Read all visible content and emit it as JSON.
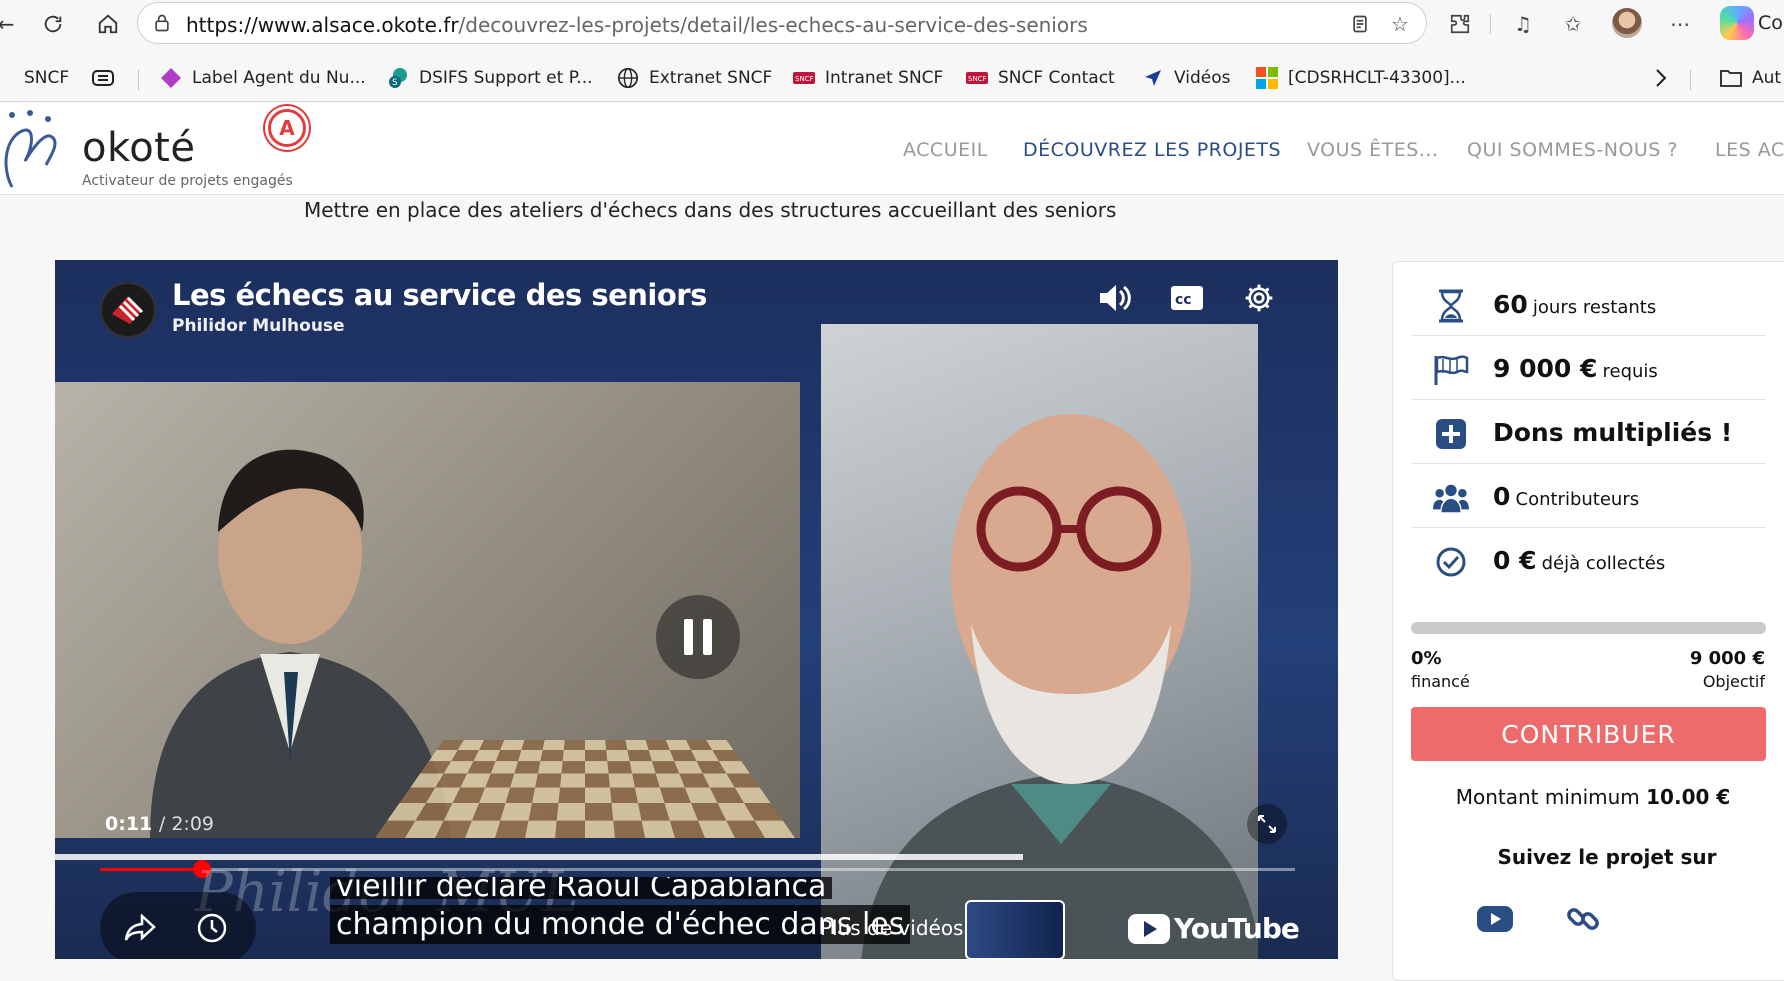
{
  "browser": {
    "url_host": "https://www.alsace.okote.fr",
    "url_path": "/decouvrez-les-projets/detail/les-echecs-au-service-des-seniors",
    "copilot_label": "Co",
    "bookmarks": [
      {
        "label": "SNCF",
        "icon": "page-icon"
      },
      {
        "label": "Label Agent du Nu...",
        "icon": "diamond-icon"
      },
      {
        "label": "DSIFS Support et P...",
        "icon": "sharepoint-icon"
      },
      {
        "label": "Extranet SNCF",
        "icon": "globe-icon"
      },
      {
        "label": "Intranet SNCF",
        "icon": "sncf-icon"
      },
      {
        "label": "SNCF Contact",
        "icon": "sncf-icon"
      },
      {
        "label": "Vidéos",
        "icon": "arrow-icon"
      },
      {
        "label": "[CDSRHCLT-43300]...",
        "icon": "microsoft-icon"
      },
      {
        "label": "Aut",
        "icon": "folder-icon"
      }
    ]
  },
  "site": {
    "logo_text": "okoté",
    "logo_tagline": "Activateur de projets engagés",
    "logo_badge": "A",
    "menu": [
      {
        "label": "ACCUEIL"
      },
      {
        "label": "DÉCOUVREZ LES PROJETS"
      },
      {
        "label": "VOUS ÊTES..."
      },
      {
        "label": "QUI SOMMES-NOUS ?"
      },
      {
        "label": "LES ACT"
      }
    ],
    "subtitle": "Mettre en place des ateliers d'échecs dans des structures accueillant des seniors"
  },
  "video": {
    "title": "Les échecs au service des seniors",
    "channel": "Philidor Mulhouse",
    "current_time": "0:11",
    "duration": "/ 2:09",
    "progress": 0.085,
    "caption_prev": "vieillir déclare Raoul Capablanca",
    "caption": "champion du monde d'échec dans les",
    "watermark": "Philidor MUL",
    "more_videos": "Plus de vidéos",
    "youtube": "YouTube"
  },
  "card": {
    "stats": [
      {
        "num": "60",
        "label": "jours restants",
        "icon": "hourglass-icon"
      },
      {
        "num": "9 000 €",
        "label": "requis",
        "icon": "flag-icon"
      },
      {
        "num": "",
        "label": "Dons multipliés !",
        "icon": "plus-square-icon"
      },
      {
        "num": "0",
        "label": "Contributeurs",
        "icon": "users-icon"
      },
      {
        "num": "0 €",
        "label": "déjà collectés",
        "icon": "check-circle-icon"
      }
    ],
    "funded_fraction": 0.0,
    "percent": "0%",
    "percent_label": "financé",
    "goal": "9 000 €",
    "goal_label": "Objectif",
    "button": "CONTRIBUER",
    "minimum_label": "Montant minimum",
    "minimum_value": "10.00 €",
    "follow": "Suivez le projet sur"
  },
  "colors": {
    "accent": "#2a4d84",
    "button": "#ef6b6b",
    "progress_red": "#ff0000"
  }
}
